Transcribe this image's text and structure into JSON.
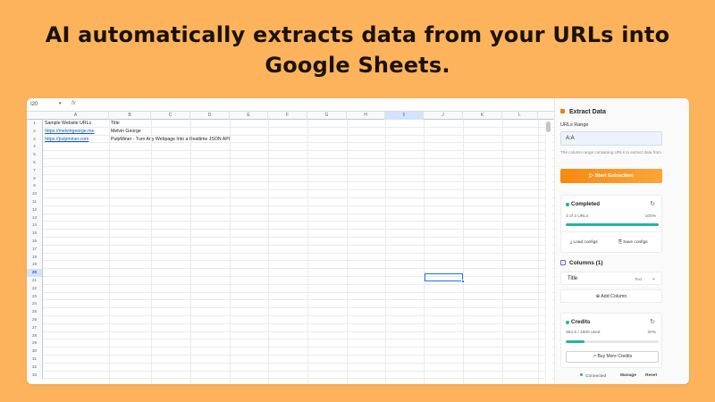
{
  "headline": {
    "line1": "AI automatically extracts data from your URLs into",
    "line2": "Google Sheets."
  },
  "sheet": {
    "name_box": "I20",
    "fx_label": "fx",
    "columns": [
      "A",
      "B",
      "C",
      "D",
      "E",
      "F",
      "G",
      "H",
      "I",
      "J",
      "K",
      "L"
    ],
    "selected_column": "I",
    "selected_row": "20",
    "row_numbers": [
      "1",
      "2",
      "3",
      "4",
      "5",
      "6",
      "7",
      "8",
      "9",
      "10",
      "11",
      "12",
      "13",
      "14",
      "15",
      "16",
      "17",
      "18",
      "19",
      "20",
      "21",
      "22",
      "23",
      "24",
      "25",
      "26",
      "27",
      "28",
      "29",
      "30",
      "31",
      "32",
      "33"
    ],
    "cells": {
      "a1": "Sample Website URLs",
      "b1": "Title",
      "a2": "https://melvingeorge.me",
      "b2": "Melvin George",
      "a3": "https://pulpminer.com",
      "b3": "PulpMiner - Turn Any Webpage Into a Realtime JSON API"
    }
  },
  "panel": {
    "title": "Extract Data",
    "urls_range_label": "URLs Range",
    "urls_range_value": "A:A",
    "urls_help": "The column range containing URLs to extract data from",
    "start_button": "▷ Start Extraction",
    "status": {
      "title": "Completed",
      "progress_text": "3 of 3 URLs",
      "progress_pct": "100%",
      "progress_fraction": 1.0,
      "load_configs": "⤓ Load configs",
      "save_configs": "⎘ Save configs"
    },
    "columns": {
      "title": "Columns (1)",
      "items": [
        {
          "name": "Title",
          "type": "Text"
        }
      ],
      "add_button": "⊕ Add Column"
    },
    "credits": {
      "title": "Credits",
      "used_text": "354.5 / 1800 used",
      "used_pct": "20%",
      "used_fraction": 0.2,
      "buy_button": "↗ Buy More Credits"
    },
    "footer": {
      "connected": "Connected",
      "manage": "Manage",
      "reset": "Reset"
    }
  },
  "colors": {
    "background": "#fdb35b",
    "accent_orange": "#f58a10",
    "progress_teal": "#22b5a0",
    "selection_blue": "#1a73e8"
  }
}
